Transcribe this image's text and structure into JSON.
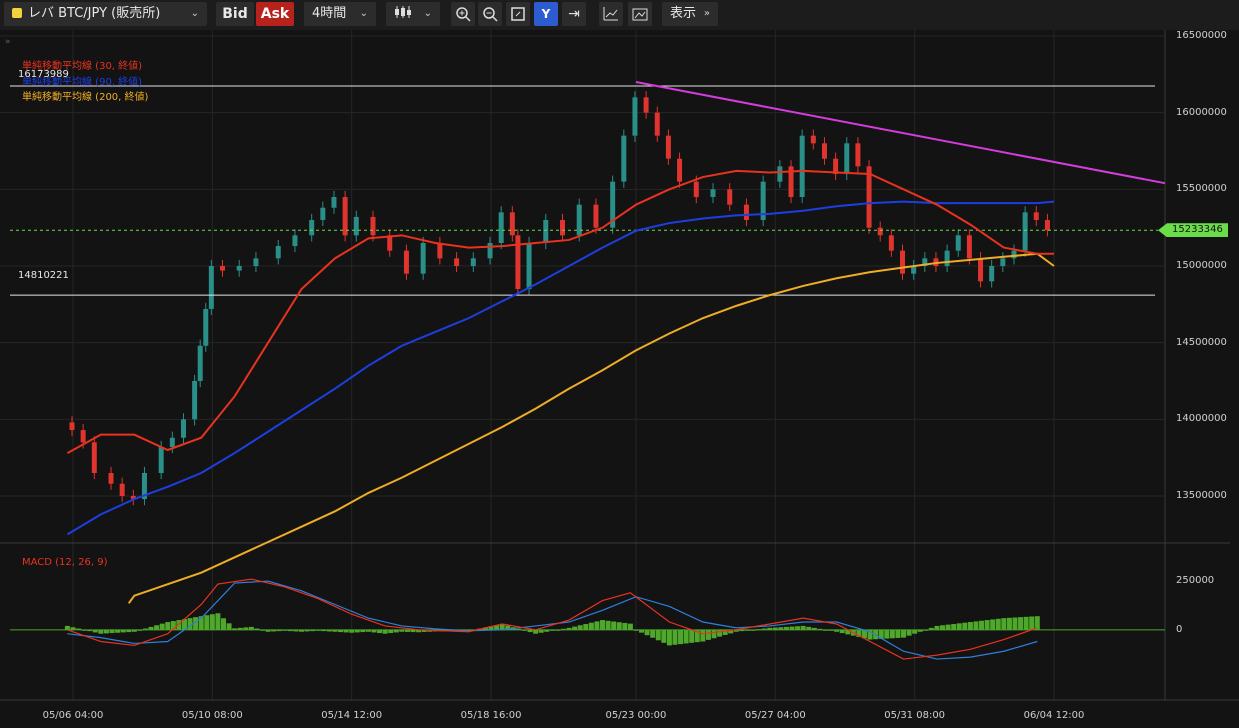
{
  "toolbar": {
    "symbol": "レバ BTC/JPY (販売所)",
    "bid_label": "Bid",
    "ask_label": "Ask",
    "timeframe": "4時間",
    "display_label": "表示"
  },
  "colors": {
    "background": "#131313",
    "up_candle": "#2a8f88",
    "down_candle": "#e0342e",
    "ma30": "#e8331f",
    "ma90": "#1d3fe0",
    "ma200": "#efad25",
    "trendline": "#d23ddc",
    "macd_line": "#e8331f",
    "signal_line": "#2f7fdc",
    "histogram": "#4ea82a",
    "current_price_flag": "#6bdc4a"
  },
  "chart_data": [
    {
      "type": "candlestick",
      "title": "",
      "x_ticks": [
        "05/06 04:00",
        "05/10 08:00",
        "05/14 12:00",
        "05/18 16:00",
        "05/23 00:00",
        "05/27 04:00",
        "05/31 08:00",
        "06/04 12:00"
      ],
      "y_ticks": [
        13500000,
        14000000,
        14500000,
        15000000,
        15500000,
        16000000,
        16500000
      ],
      "ylim": [
        13200000,
        16500000
      ],
      "indicators": [
        {
          "name": "単純移動平均線 (30, 終値)"
        },
        {
          "name": "単純移動平均線 (90, 終値)"
        },
        {
          "name": "単純移動平均線 (200, 終値)"
        }
      ],
      "horizontal_lines": [
        16173989,
        14810221
      ],
      "current_price": 15233346,
      "trendline": {
        "from": [
          "05/23 00:00",
          16200000
        ],
        "to_price_at_right_edge": 15540000
      },
      "close_path": [
        [
          "05/06 00:00",
          13980000
        ],
        [
          "05/06 04:00",
          13930000
        ],
        [
          "05/06 12:00",
          13850000
        ],
        [
          "05/06 20:00",
          13650000
        ],
        [
          "05/07 08:00",
          13580000
        ],
        [
          "05/07 16:00",
          13500000
        ],
        [
          "05/08 00:00",
          13480000
        ],
        [
          "05/08 08:00",
          13650000
        ],
        [
          "05/08 20:00",
          13820000
        ],
        [
          "05/09 04:00",
          13880000
        ],
        [
          "05/09 12:00",
          14000000
        ],
        [
          "05/09 20:00",
          14250000
        ],
        [
          "05/10 00:00",
          14480000
        ],
        [
          "05/10 04:00",
          14720000
        ],
        [
          "05/10 08:00",
          15000000
        ],
        [
          "05/10 16:00",
          14970000
        ],
        [
          "05/11 04:00",
          15000000
        ],
        [
          "05/11 16:00",
          15050000
        ],
        [
          "05/12 08:00",
          15130000
        ],
        [
          "05/12 20:00",
          15200000
        ],
        [
          "05/13 08:00",
          15300000
        ],
        [
          "05/13 16:00",
          15380000
        ],
        [
          "05/14 00:00",
          15450000
        ],
        [
          "05/14 08:00",
          15200000
        ],
        [
          "05/14 16:00",
          15320000
        ],
        [
          "05/15 04:00",
          15200000
        ],
        [
          "05/15 16:00",
          15100000
        ],
        [
          "05/16 04:00",
          14950000
        ],
        [
          "05/16 16:00",
          15150000
        ],
        [
          "05/17 04:00",
          15050000
        ],
        [
          "05/17 16:00",
          15000000
        ],
        [
          "05/18 04:00",
          15050000
        ],
        [
          "05/18 16:00",
          15150000
        ],
        [
          "05/19 00:00",
          15350000
        ],
        [
          "05/19 08:00",
          15200000
        ],
        [
          "05/19 12:00",
          14850000
        ],
        [
          "05/19 20:00",
          15150000
        ],
        [
          "05/20 08:00",
          15300000
        ],
        [
          "05/20 20:00",
          15200000
        ],
        [
          "05/21 08:00",
          15400000
        ],
        [
          "05/21 20:00",
          15250000
        ],
        [
          "05/22 08:00",
          15550000
        ],
        [
          "05/22 16:00",
          15850000
        ],
        [
          "05/23 00:00",
          16100000
        ],
        [
          "05/23 08:00",
          16000000
        ],
        [
          "05/23 16:00",
          15850000
        ],
        [
          "05/24 00:00",
          15700000
        ],
        [
          "05/24 08:00",
          15550000
        ],
        [
          "05/24 20:00",
          15450000
        ],
        [
          "05/25 08:00",
          15500000
        ],
        [
          "05/25 20:00",
          15400000
        ],
        [
          "05/26 08:00",
          15300000
        ],
        [
          "05/26 20:00",
          15550000
        ],
        [
          "05/27 08:00",
          15650000
        ],
        [
          "05/27 16:00",
          15450000
        ],
        [
          "05/28 00:00",
          15850000
        ],
        [
          "05/28 08:00",
          15800000
        ],
        [
          "05/28 16:00",
          15700000
        ],
        [
          "05/29 00:00",
          15600000
        ],
        [
          "05/29 08:00",
          15800000
        ],
        [
          "05/29 16:00",
          15650000
        ],
        [
          "05/30 00:00",
          15250000
        ],
        [
          "05/30 08:00",
          15200000
        ],
        [
          "05/30 16:00",
          15100000
        ],
        [
          "05/31 00:00",
          14950000
        ],
        [
          "05/31 08:00",
          15000000
        ],
        [
          "05/31 16:00",
          15050000
        ],
        [
          "06/01 00:00",
          15000000
        ],
        [
          "06/01 08:00",
          15100000
        ],
        [
          "06/01 16:00",
          15200000
        ],
        [
          "06/02 00:00",
          15050000
        ],
        [
          "06/02 08:00",
          14900000
        ],
        [
          "06/02 16:00",
          15000000
        ],
        [
          "06/03 00:00",
          15050000
        ],
        [
          "06/03 08:00",
          15100000
        ],
        [
          "06/03 16:00",
          15350000
        ],
        [
          "06/04 00:00",
          15300000
        ],
        [
          "06/04 08:00",
          15233346
        ]
      ],
      "ma30_path": [
        [
          "05/06 00:00",
          13780000
        ],
        [
          "05/07 00:00",
          13900000
        ],
        [
          "05/08 00:00",
          13900000
        ],
        [
          "05/09 00:00",
          13800000
        ],
        [
          "05/10 00:00",
          13880000
        ],
        [
          "05/11 00:00",
          14150000
        ],
        [
          "05/12 00:00",
          14500000
        ],
        [
          "05/13 00:00",
          14850000
        ],
        [
          "05/14 00:00",
          15050000
        ],
        [
          "05/15 00:00",
          15180000
        ],
        [
          "05/16 00:00",
          15200000
        ],
        [
          "05/17 00:00",
          15150000
        ],
        [
          "05/18 00:00",
          15120000
        ],
        [
          "05/19 00:00",
          15130000
        ],
        [
          "05/20 00:00",
          15150000
        ],
        [
          "05/21 00:00",
          15170000
        ],
        [
          "05/22 00:00",
          15250000
        ],
        [
          "05/23 00:00",
          15400000
        ],
        [
          "05/24 00:00",
          15500000
        ],
        [
          "05/25 00:00",
          15580000
        ],
        [
          "05/26 00:00",
          15620000
        ],
        [
          "05/27 00:00",
          15610000
        ],
        [
          "05/28 00:00",
          15620000
        ],
        [
          "05/29 00:00",
          15610000
        ],
        [
          "05/30 00:00",
          15600000
        ],
        [
          "05/31 00:00",
          15500000
        ],
        [
          "06/01 00:00",
          15400000
        ],
        [
          "06/02 00:00",
          15270000
        ],
        [
          "06/03 00:00",
          15120000
        ],
        [
          "06/04 00:00",
          15080000
        ],
        [
          "06/04 12:00",
          15080000
        ]
      ],
      "ma90_path": [
        [
          "05/06 00:00",
          13250000
        ],
        [
          "05/07 00:00",
          13380000
        ],
        [
          "05/08 00:00",
          13480000
        ],
        [
          "05/09 00:00",
          13560000
        ],
        [
          "05/10 00:00",
          13650000
        ],
        [
          "05/11 00:00",
          13780000
        ],
        [
          "05/12 00:00",
          13920000
        ],
        [
          "05/13 00:00",
          14060000
        ],
        [
          "05/14 00:00",
          14200000
        ],
        [
          "05/15 00:00",
          14350000
        ],
        [
          "05/16 00:00",
          14480000
        ],
        [
          "05/17 00:00",
          14570000
        ],
        [
          "05/18 00:00",
          14660000
        ],
        [
          "05/19 00:00",
          14770000
        ],
        [
          "05/20 00:00",
          14880000
        ],
        [
          "05/21 00:00",
          15000000
        ],
        [
          "05/22 00:00",
          15120000
        ],
        [
          "05/23 00:00",
          15230000
        ],
        [
          "05/24 00:00",
          15280000
        ],
        [
          "05/25 00:00",
          15310000
        ],
        [
          "05/26 00:00",
          15330000
        ],
        [
          "05/27 00:00",
          15340000
        ],
        [
          "05/28 00:00",
          15360000
        ],
        [
          "05/29 00:00",
          15390000
        ],
        [
          "05/30 00:00",
          15410000
        ],
        [
          "05/31 00:00",
          15420000
        ],
        [
          "06/01 00:00",
          15410000
        ],
        [
          "06/02 00:00",
          15410000
        ],
        [
          "06/03 00:00",
          15410000
        ],
        [
          "06/04 00:00",
          15410000
        ],
        [
          "06/04 12:00",
          15420000
        ]
      ],
      "ma200_path": [
        [
          "05/07 20:00",
          12800000
        ],
        [
          "05/08 00:00",
          12850000
        ],
        [
          "05/10 00:00",
          13000000
        ],
        [
          "05/11 00:00",
          13100000
        ],
        [
          "05/12 00:00",
          13200000
        ],
        [
          "05/13 00:00",
          13300000
        ],
        [
          "05/14 00:00",
          13400000
        ],
        [
          "05/15 00:00",
          13520000
        ],
        [
          "05/16 00:00",
          13620000
        ],
        [
          "05/17 00:00",
          13730000
        ],
        [
          "05/18 00:00",
          13840000
        ],
        [
          "05/19 00:00",
          13950000
        ],
        [
          "05/20 00:00",
          14070000
        ],
        [
          "05/21 00:00",
          14200000
        ],
        [
          "05/22 00:00",
          14320000
        ],
        [
          "05/23 00:00",
          14450000
        ],
        [
          "05/24 00:00",
          14560000
        ],
        [
          "05/25 00:00",
          14660000
        ],
        [
          "05/26 00:00",
          14740000
        ],
        [
          "05/27 00:00",
          14810000
        ],
        [
          "05/28 00:00",
          14870000
        ],
        [
          "05/29 00:00",
          14920000
        ],
        [
          "05/30 00:00",
          14960000
        ],
        [
          "05/31 00:00",
          14990000
        ],
        [
          "06/01 00:00",
          15020000
        ],
        [
          "06/02 00:00",
          15040000
        ],
        [
          "06/03 00:00",
          15060000
        ],
        [
          "06/04 00:00",
          15080000
        ],
        [
          "06/04 12:00",
          15000000
        ]
      ]
    },
    {
      "type": "macd",
      "label": "MACD (12, 26, 9)",
      "y_ticks": [
        0,
        250000
      ],
      "ylim": [
        -350000,
        420000
      ],
      "macd_path": [
        [
          "05/06 00:00",
          0
        ],
        [
          "05/07 00:00",
          -60000
        ],
        [
          "05/08 00:00",
          -80000
        ],
        [
          "05/09 00:00",
          -20000
        ],
        [
          "05/10 00:00",
          130000
        ],
        [
          "05/10 12:00",
          235000
        ],
        [
          "05/11 12:00",
          260000
        ],
        [
          "05/12 12:00",
          220000
        ],
        [
          "05/13 12:00",
          160000
        ],
        [
          "05/14 12:00",
          80000
        ],
        [
          "05/15 12:00",
          20000
        ],
        [
          "05/16 12:00",
          0
        ],
        [
          "05/18 00:00",
          -10000
        ],
        [
          "05/19 00:00",
          30000
        ],
        [
          "05/20 00:00",
          0
        ],
        [
          "05/21 00:00",
          50000
        ],
        [
          "05/22 00:00",
          150000
        ],
        [
          "05/22 20:00",
          190000
        ],
        [
          "05/24 00:00",
          40000
        ],
        [
          "05/25 00:00",
          -20000
        ],
        [
          "05/26 00:00",
          0
        ],
        [
          "05/27 00:00",
          30000
        ],
        [
          "05/28 00:00",
          60000
        ],
        [
          "05/29 00:00",
          30000
        ],
        [
          "05/30 00:00",
          -60000
        ],
        [
          "05/31 00:00",
          -150000
        ],
        [
          "06/01 00:00",
          -130000
        ],
        [
          "06/02 00:00",
          -100000
        ],
        [
          "06/03 00:00",
          -50000
        ],
        [
          "06/04 00:00",
          10000
        ]
      ],
      "signal_path": [
        [
          "05/06 00:00",
          -20000
        ],
        [
          "05/07 00:00",
          -40000
        ],
        [
          "05/08 00:00",
          -70000
        ],
        [
          "05/09 00:00",
          -60000
        ],
        [
          "05/10 00:00",
          60000
        ],
        [
          "05/11 00:00",
          240000
        ],
        [
          "05/12 00:00",
          250000
        ],
        [
          "05/13 00:00",
          200000
        ],
        [
          "05/14 00:00",
          130000
        ],
        [
          "05/15 00:00",
          60000
        ],
        [
          "05/16 00:00",
          20000
        ],
        [
          "05/17 00:00",
          5000
        ],
        [
          "05/18 00:00",
          -5000
        ],
        [
          "05/19 00:00",
          0
        ],
        [
          "05/20 00:00",
          20000
        ],
        [
          "05/21 00:00",
          40000
        ],
        [
          "05/22 00:00",
          100000
        ],
        [
          "05/23 00:00",
          170000
        ],
        [
          "05/24 00:00",
          120000
        ],
        [
          "05/25 00:00",
          40000
        ],
        [
          "05/26 00:00",
          10000
        ],
        [
          "05/27 00:00",
          20000
        ],
        [
          "05/28 00:00",
          40000
        ],
        [
          "05/29 00:00",
          40000
        ],
        [
          "05/30 00:00",
          -10000
        ],
        [
          "05/31 00:00",
          -110000
        ],
        [
          "06/01 00:00",
          -150000
        ],
        [
          "06/02 00:00",
          -140000
        ],
        [
          "06/03 00:00",
          -110000
        ],
        [
          "06/04 00:00",
          -60000
        ]
      ]
    }
  ]
}
